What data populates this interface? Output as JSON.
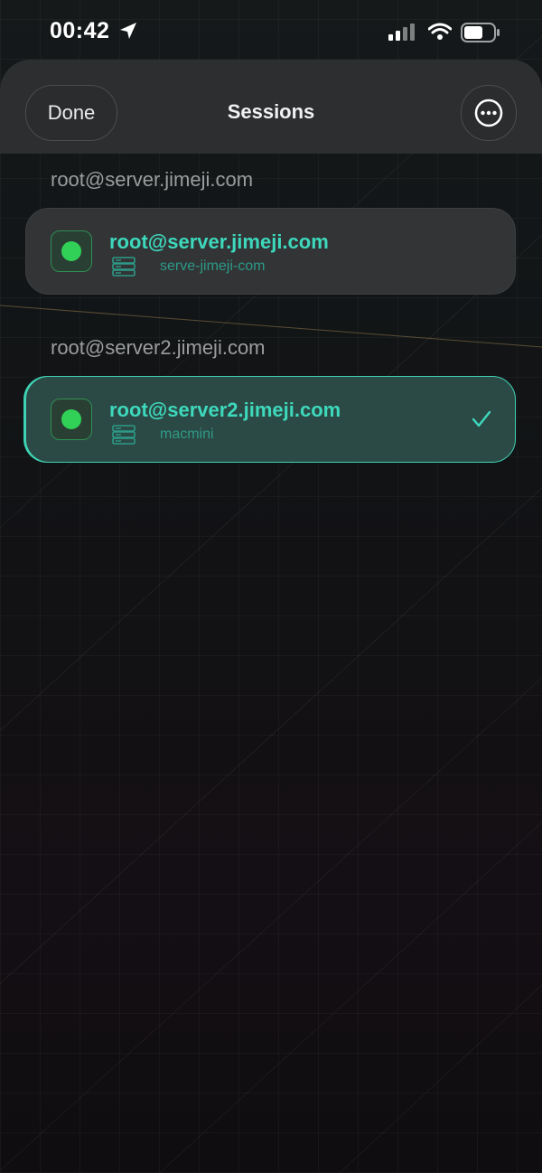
{
  "status_bar": {
    "time": "00:42"
  },
  "header": {
    "done_label": "Done",
    "title": "Sessions"
  },
  "sessions": [
    {
      "section_label": "root@server.jimeji.com",
      "title": "root@server.jimeji.com",
      "subtitle": "serve-jimeji-com",
      "selected": false,
      "status": "connected"
    },
    {
      "section_label": "root@server2.jimeji.com",
      "title": "root@server2.jimeji.com",
      "subtitle": "macmini",
      "selected": true,
      "status": "connected"
    }
  ],
  "colors": {
    "accent": "#3dd9bd",
    "status_green": "#31d158",
    "background": "#0d0f10"
  }
}
